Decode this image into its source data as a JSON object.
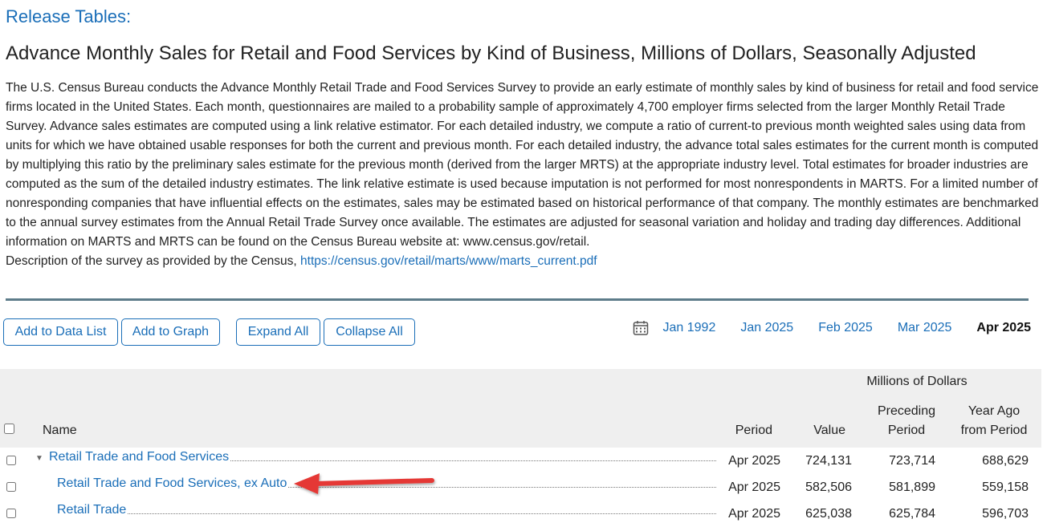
{
  "header": {
    "heading": "Release Tables:",
    "title": "Advance Monthly Sales for Retail and Food Services by Kind of Business, Millions of Dollars, Seasonally Adjusted"
  },
  "description": {
    "body": "The U.S. Census Bureau conducts the Advance Monthly Retail Trade and Food Services Survey to provide an early estimate of monthly sales by kind of business for retail and food service firms located in the United States. Each month, questionnaires are mailed to a probability sample of approximately 4,700 employer firms selected from the larger Monthly Retail Trade Survey. Advance sales estimates are computed using a link relative estimator. For each detailed industry, we compute a ratio of current-to previous month weighted sales using data from units for which we have obtained usable responses for both the current and previous month. For each detailed industry, the advance total sales estimates for the current month is computed by multiplying this ratio by the preliminary sales estimate for the previous month (derived from the larger MRTS) at the appropriate industry level. Total estimates for broader industries are computed as the sum of the detailed industry estimates. The link relative estimate is used because imputation is not performed for most nonrespondents in MARTS. For a limited number of nonresponding companies that have influential effects on the estimates, sales may be estimated based on historical performance of that company. The monthly estimates are benchmarked to the annual survey estimates from the Annual Retail Trade Survey once available. The estimates are adjusted for seasonal variation and holiday and trading day differences. Additional information on MARTS and MRTS can be found on the Census Bureau website at: www.census.gov/retail.",
    "source_prefix": "Description of the survey as provided by the Census, ",
    "source_link": "https://census.gov/retail/marts/www/marts_current.pdf"
  },
  "toolbar": {
    "add_to_data_list": "Add to Data List",
    "add_to_graph": "Add to Graph",
    "expand_all": "Expand All",
    "collapse_all": "Collapse All"
  },
  "period_nav": {
    "links": [
      "Jan 1992",
      "Jan 2025",
      "Feb 2025",
      "Mar 2025"
    ],
    "current": "Apr 2025"
  },
  "table": {
    "units_label": "Millions of Dollars",
    "columns": {
      "name": "Name",
      "period": "Period",
      "value": "Value",
      "preceding_1": "Preceding",
      "preceding_2": "Period",
      "year_ago_1": "Year Ago",
      "year_ago_2": "from Period"
    },
    "rows": [
      {
        "name": "Retail Trade and Food Services",
        "period": "Apr 2025",
        "value": "724,131",
        "preceding": "723,714",
        "year_ago": "688,629"
      },
      {
        "name": "Retail Trade and Food Services, ex Auto",
        "period": "Apr 2025",
        "value": "582,506",
        "preceding": "581,899",
        "year_ago": "559,158"
      },
      {
        "name": "Retail Trade",
        "period": "Apr 2025",
        "value": "625,038",
        "preceding": "625,784",
        "year_ago": "596,703"
      }
    ]
  },
  "colors": {
    "link": "#1a6eb8",
    "annotation_arrow": "#e53935",
    "header_bg": "#efefef",
    "divider": "#5d7c8a"
  },
  "icons": {
    "calendar": "calendar-icon",
    "expand_caret": "caret-down-icon",
    "annotation": "red-arrow-annotation"
  }
}
